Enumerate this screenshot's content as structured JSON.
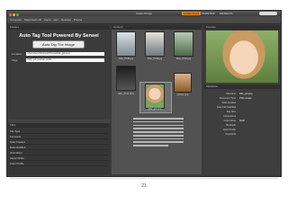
{
  "window": {
    "title": "Adobe Bridge",
    "workspaces": [
      "ESSENTIALS",
      "FILMSTRIP",
      "METADATA"
    ],
    "active_workspace": "ESSENTIALS"
  },
  "toolbar": {
    "path": [
      "Computer",
      "Macintosh HD",
      "Users",
      "sam",
      "Desktop",
      "Photos"
    ]
  },
  "panels": {
    "folders": "Folders",
    "content": "Content",
    "preview": "Preview",
    "filter": "Filter",
    "metadata": "Metadata"
  },
  "plugin": {
    "title": "Auto Tag Tool Powered By Sensei",
    "button": "Auto Tag The Image",
    "location_label": "Location",
    "location_value": "/Users/sam/Desktop/Photos/little_girl.png",
    "tags_label": "Tags",
    "tags_value": "child, girl, portrait, smile"
  },
  "filter": {
    "rows": [
      {
        "label": "File Type",
        "count": ""
      },
      {
        "label": "Keywords",
        "count": ""
      },
      {
        "label": "Date Created",
        "count": ""
      },
      {
        "label": "Date Modified",
        "count": ""
      },
      {
        "label": "Orientation",
        "count": ""
      },
      {
        "label": "Aspect Ratio",
        "count": ""
      },
      {
        "label": "Color Profile",
        "count": ""
      }
    ]
  },
  "content": {
    "thumbs": [
      {
        "label": "IMG_0738.jpg",
        "color": "#b8c4c8"
      },
      {
        "label": "IMG_0739.jpg",
        "color": "#a9b8bf"
      },
      {
        "label": "IMG_0740.jpg",
        "color": "#8aa08a"
      },
      {
        "label": "IMG_0741.JPG",
        "color": "#3a3a3a"
      },
      {
        "label": "little_girl.png",
        "color": "#e2c7a8"
      },
      {
        "label": "pitcher.png",
        "color": "#c79a6a"
      }
    ]
  },
  "metadata": {
    "rows": [
      {
        "k": "Filename",
        "v": "little_girl.png"
      },
      {
        "k": "Document Type",
        "v": "PNG image"
      },
      {
        "k": "Date Created",
        "v": ""
      },
      {
        "k": "Date File Modified",
        "v": ""
      },
      {
        "k": "File Size",
        "v": ""
      },
      {
        "k": "Dimensions",
        "v": ""
      },
      {
        "k": "Color Mode",
        "v": "RGB"
      },
      {
        "k": "Bit Depth",
        "v": ""
      },
      {
        "k": "Color Profile",
        "v": ""
      },
      {
        "k": "Keywords",
        "v": ""
      }
    ]
  },
  "page": {
    "number": "21"
  },
  "colors": {
    "accent": "#d58a2a",
    "panel": "#3b3b3b"
  }
}
